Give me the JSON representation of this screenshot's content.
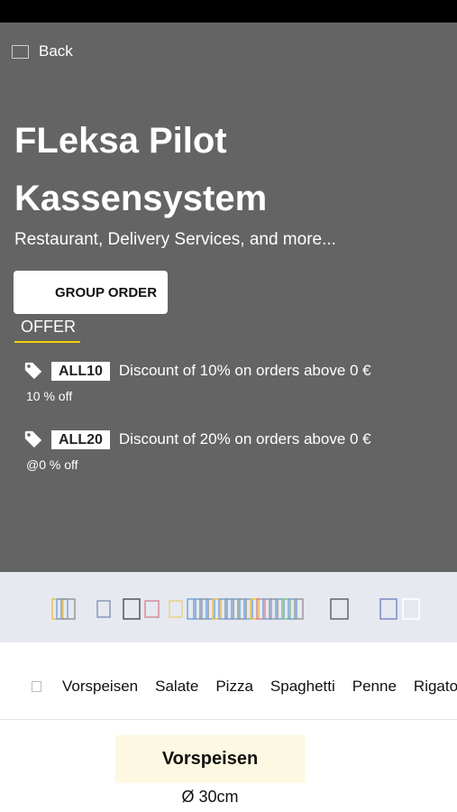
{
  "nav": {
    "back_label": "Back"
  },
  "restaurant": {
    "name": "FLeksa Pilot Kassensystem",
    "subtitle": "Restaurant, Delivery Services, and more..."
  },
  "actions": {
    "group_order_label": "GROUP ORDER"
  },
  "tabs": {
    "offer_label": "OFFER"
  },
  "offers": [
    {
      "code": "ALL10",
      "description": "Discount of 10% on orders above 0 €",
      "note": "10 % off",
      "icon": "tag-icon"
    },
    {
      "code": "ALL20",
      "description": "Discount of 20% on orders above 0 €",
      "note": "@0 % off",
      "icon": "tag-icon"
    }
  ],
  "categories": [
    "Vorspeisen",
    "Salate",
    "Pizza",
    "Spaghetti",
    "Penne",
    "Rigatoni"
  ],
  "menu_section": {
    "title": "Vorspeisen",
    "size": "Ø 30cm"
  },
  "colors": {
    "hero": "#646464",
    "offer_underline": "#f0d000",
    "section_bg": "#fdf8e1",
    "strip_bg": "#e6e9f0"
  }
}
